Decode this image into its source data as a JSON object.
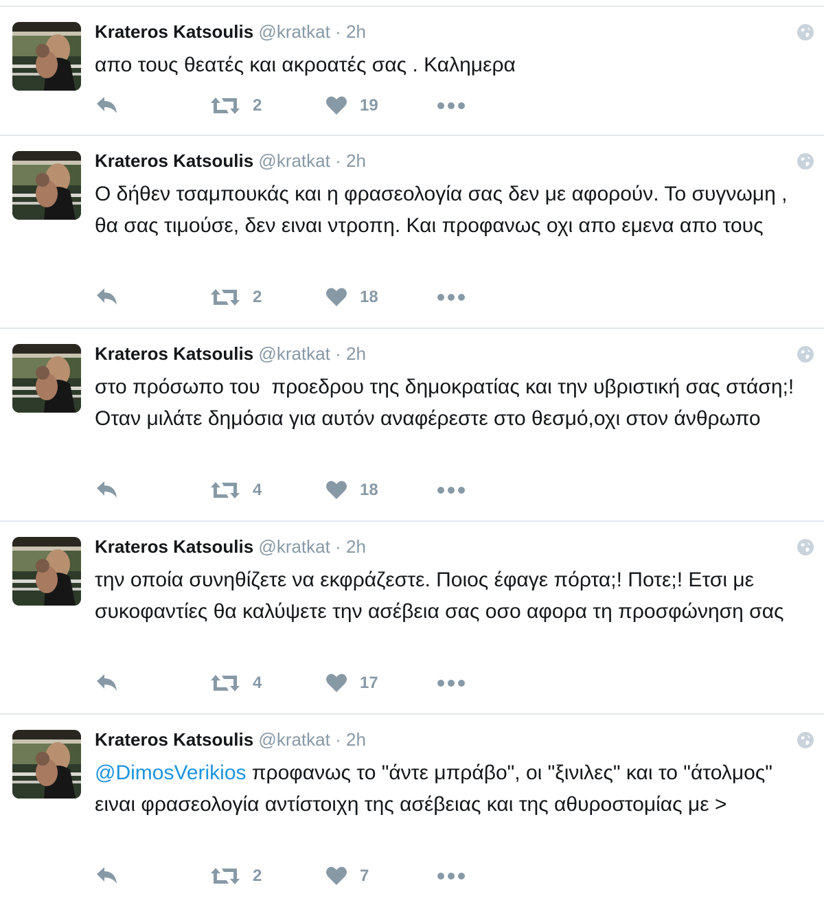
{
  "colors": {
    "accent": "#1b95e0",
    "muted": "#8899a6",
    "icon": "#8899a6",
    "border": "#e1e8ed"
  },
  "tweets": [
    {
      "name": "Krateros Katsoulis",
      "handle": "@kratkat",
      "separator": "·",
      "time": "2h",
      "mention": "",
      "text": "απο τους θεατές και ακροατές σας . Καλημερα",
      "retweets": "2",
      "likes": "19"
    },
    {
      "name": "Krateros Katsoulis",
      "handle": "@kratkat",
      "separator": "·",
      "time": "2h",
      "mention": "",
      "text": "Ο δήθεν τσαμπουκάς και η φρασεολογία σας δεν με αφορούν. Το συγνωμη ,  θα σας τιμούσε, δεν ειναι ντροπη. Και προφανως οχι απο εμενα απο τους",
      "retweets": "2",
      "likes": "18"
    },
    {
      "name": "Krateros Katsoulis",
      "handle": "@kratkat",
      "separator": "·",
      "time": "2h",
      "mention": "",
      "text": "στο πρόσωπο του  προεδρου της δημοκρατίας και την υβριστική σας στάση;!  Οταν μιλάτε δημόσια για αυτόν αναφέρεστε στο θεσμό,οχι στον άνθρωπο",
      "retweets": "4",
      "likes": "18"
    },
    {
      "name": "Krateros Katsoulis",
      "handle": "@kratkat",
      "separator": "·",
      "time": "2h",
      "mention": "",
      "text": "την οποία συνηθίζετε να εκφράζεστε. Ποιος έφαγε πόρτα;! Ποτε;! Ετσι με  συκοφαντίες θα καλύψετε την ασέβεια σας οσο αφορα τη προσφώνηση σας",
      "retweets": "4",
      "likes": "17"
    },
    {
      "name": "Krateros Katsoulis",
      "handle": "@kratkat",
      "separator": "·",
      "time": "2h",
      "mention": "@DimosVerikios",
      "text": " προφανως το \"άντε μπράβο\", οι \"ξινιλες\" και το \"άτολμος\" ειναι φρασεολογία αντίστοιχη της ασέβειας και της αθυροστομίας με >",
      "retweets": "2",
      "likes": "7"
    }
  ]
}
